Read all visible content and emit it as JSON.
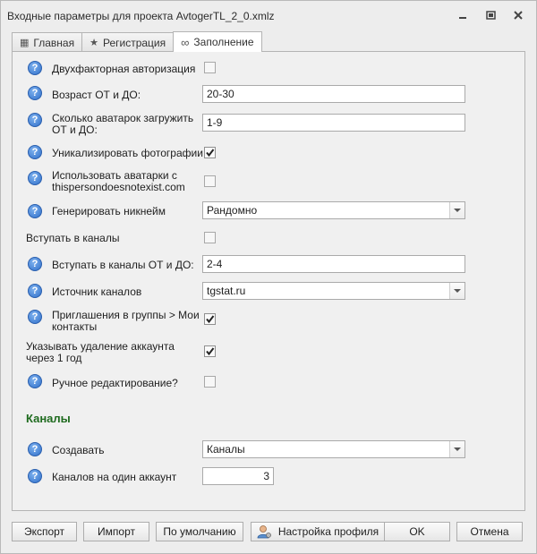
{
  "window": {
    "title": "Входные параметры для проекта AvtogerTL_2_0.xmlz"
  },
  "tabs": [
    {
      "label": "Главная",
      "icon": "grid-icon",
      "active": false
    },
    {
      "label": "Регистрация",
      "icon": "star-icon",
      "active": false
    },
    {
      "label": "Заполнение",
      "icon": "infinity-icon",
      "active": true
    }
  ],
  "form": {
    "two_factor": {
      "label": "Двухфакторная авторизация",
      "checked": false
    },
    "age": {
      "label": "Возраст ОТ и ДО:",
      "value": "20-30"
    },
    "avatars_count": {
      "label": "Сколько аватарок загружить ОТ и ДО:",
      "value": "1-9"
    },
    "unique_photos": {
      "label": "Уникализировать фотографии",
      "checked": true
    },
    "use_tpdne": {
      "label": "Использовать аватарки с thispersondoesnotexist.com",
      "checked": false
    },
    "gen_nickname": {
      "label": "Генерировать никнейм",
      "value": "Рандомно"
    },
    "join_channels": {
      "label": "Вступать в каналы",
      "checked": false
    },
    "join_channels_range": {
      "label": "Вступать в каналы ОТ и ДО:",
      "value": "2-4"
    },
    "channel_source": {
      "label": "Источник каналов",
      "value": "tgstat.ru"
    },
    "group_invites": {
      "label": "Приглашения в группы > Мои контакты",
      "checked": true
    },
    "delete_after_year": {
      "label": "Указывать удаление аккаунта через 1 год",
      "checked": true
    },
    "manual_edit": {
      "label": "Ручное редактирование?",
      "checked": false
    }
  },
  "channels_section": {
    "title": "Каналы",
    "create": {
      "label": "Создавать",
      "value": "Каналы"
    },
    "per_account": {
      "label": "Каналов на один аккаунт",
      "value": "3"
    }
  },
  "buttons": {
    "export": "Экспорт",
    "import": "Импорт",
    "defaults": "По умолчанию",
    "profile": "Настройка профиля",
    "ok": "OK",
    "cancel": "Отмена"
  },
  "colors": {
    "section_title": "#1f6b1f",
    "help_icon": "#2f6fc9"
  }
}
